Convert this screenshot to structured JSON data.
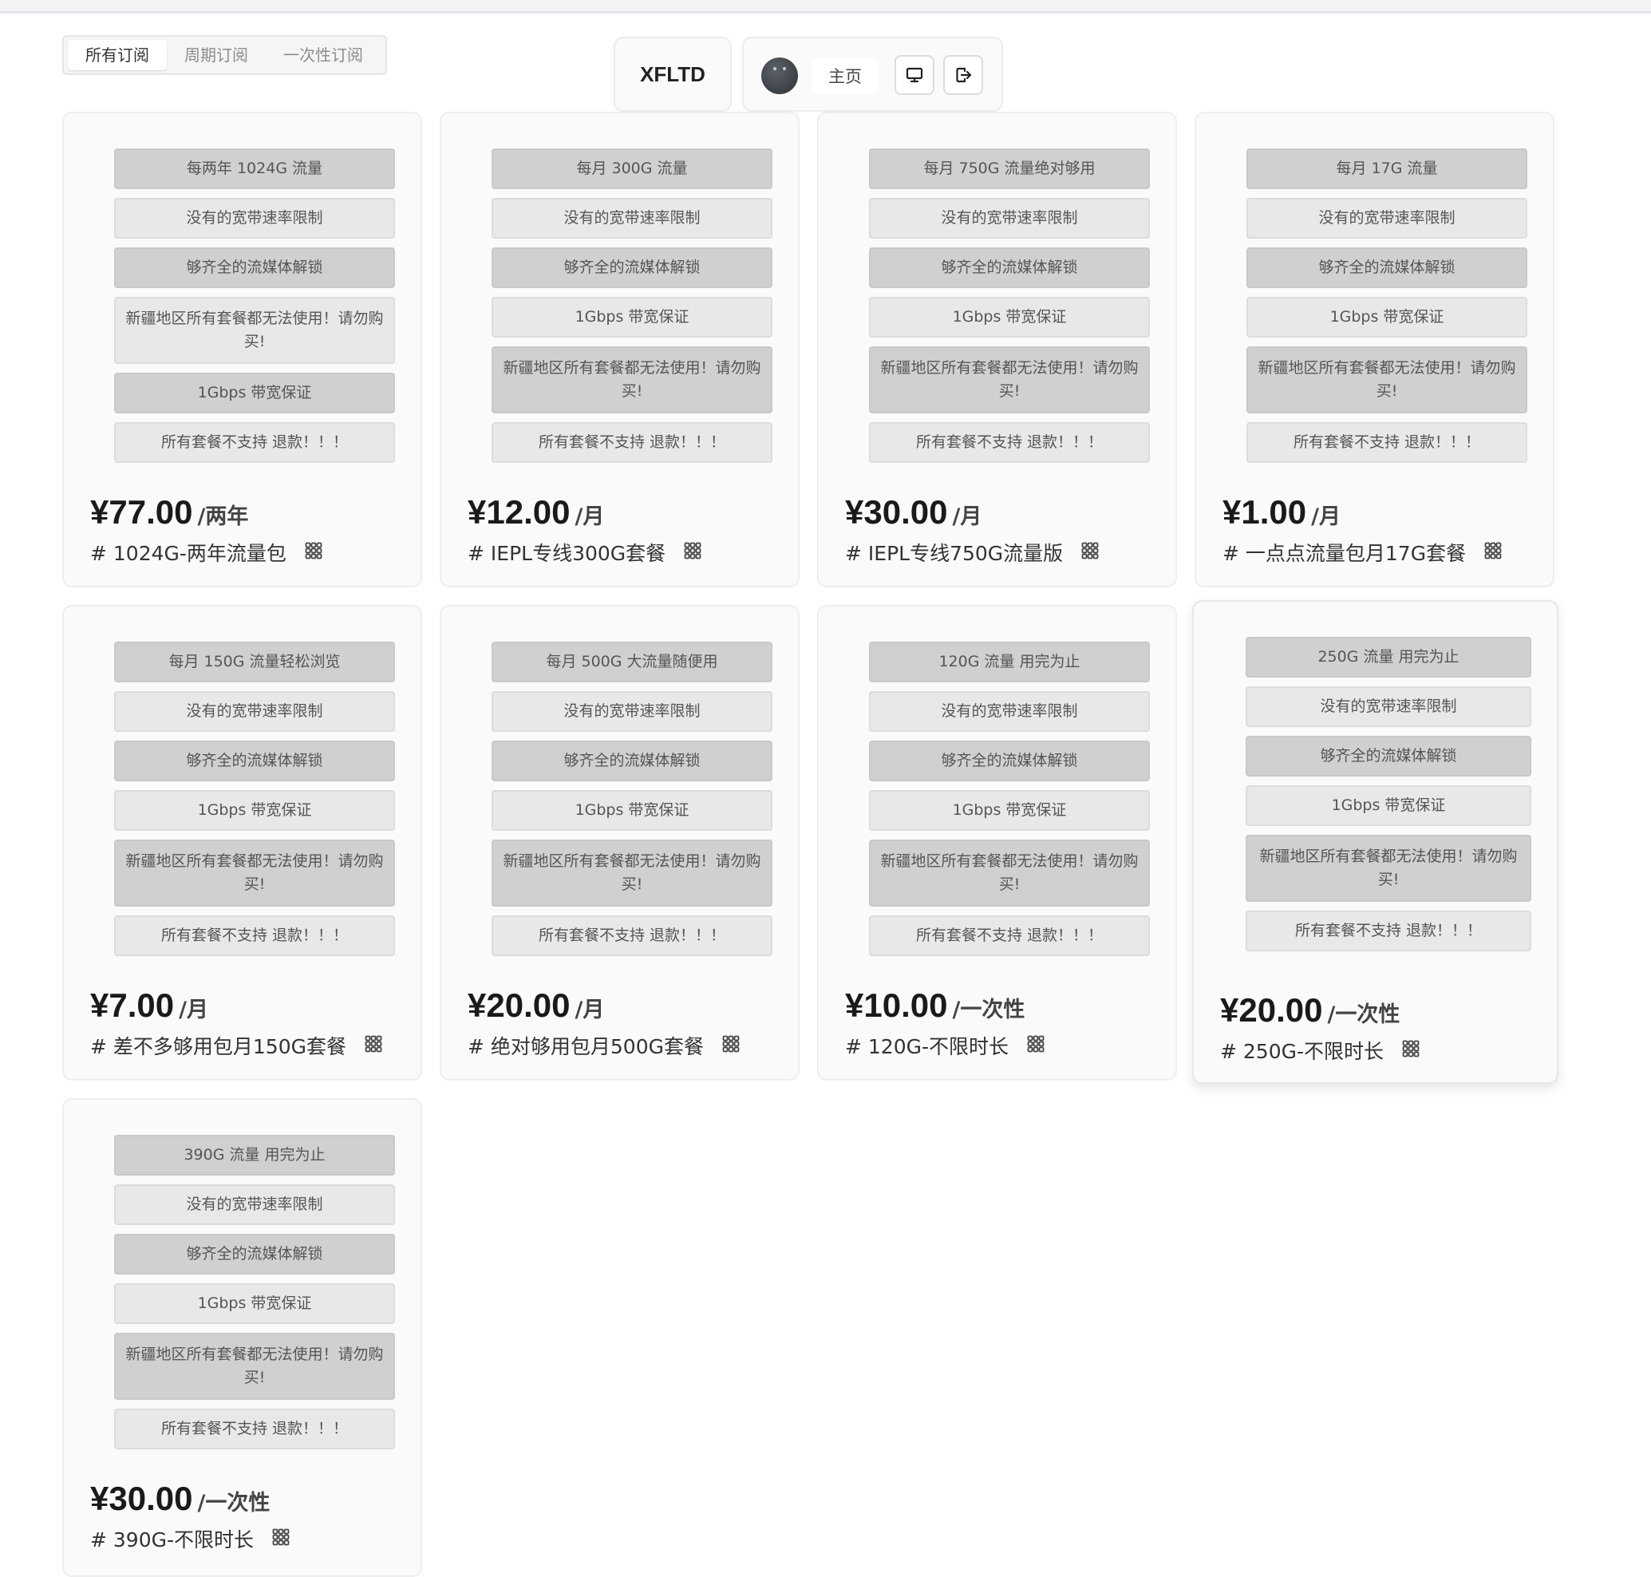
{
  "tabs": [
    "所有订阅",
    "周期订阅",
    "一次性订阅"
  ],
  "header": {
    "brand": "XFLTD",
    "home_label": "主页"
  },
  "icons": {
    "desktop": "desktop-icon",
    "logout": "logout-icon",
    "grid": "grid-icon"
  },
  "plans": [
    {
      "features": [
        "每两年 1024G 流量",
        "没有的宽带速率限制",
        "够齐全的流媒体解锁",
        "新疆地区所有套餐都无法使用！请勿购买!",
        "1Gbps 带宽保证",
        "所有套餐不支持 退款！！！"
      ],
      "price": "¥77.00",
      "period": "/两年",
      "name": "# 1024G-两年流量包"
    },
    {
      "features": [
        "每月 300G 流量",
        "没有的宽带速率限制",
        "够齐全的流媒体解锁",
        "1Gbps 带宽保证",
        "新疆地区所有套餐都无法使用！请勿购买!",
        "所有套餐不支持 退款！！！"
      ],
      "price": "¥12.00",
      "period": "/月",
      "name": "# IEPL专线300G套餐"
    },
    {
      "features": [
        "每月 750G 流量绝对够用",
        "没有的宽带速率限制",
        "够齐全的流媒体解锁",
        "1Gbps 带宽保证",
        "新疆地区所有套餐都无法使用！请勿购买!",
        "所有套餐不支持 退款！！！"
      ],
      "price": "¥30.00",
      "period": "/月",
      "name": "# IEPL专线750G流量版"
    },
    {
      "features": [
        "每月 17G 流量",
        "没有的宽带速率限制",
        "够齐全的流媒体解锁",
        "1Gbps 带宽保证",
        "新疆地区所有套餐都无法使用！请勿购买!",
        "所有套餐不支持 退款！！！"
      ],
      "price": "¥1.00",
      "period": "/月",
      "name": "# 一点点流量包月17G套餐"
    },
    {
      "features": [
        "每月 150G 流量轻松浏览",
        "没有的宽带速率限制",
        "够齐全的流媒体解锁",
        "1Gbps 带宽保证",
        "新疆地区所有套餐都无法使用！请勿购买!",
        "所有套餐不支持 退款！！！"
      ],
      "price": "¥7.00",
      "period": "/月",
      "name": "# 差不多够用包月150G套餐"
    },
    {
      "features": [
        "每月 500G 大流量随便用",
        "没有的宽带速率限制",
        "够齐全的流媒体解锁",
        "1Gbps 带宽保证",
        "新疆地区所有套餐都无法使用！请勿购买!",
        "所有套餐不支持 退款！！！"
      ],
      "price": "¥20.00",
      "period": "/月",
      "name": "# 绝对够用包月500G套餐"
    },
    {
      "features": [
        "120G 流量 用完为止",
        "没有的宽带速率限制",
        "够齐全的流媒体解锁",
        "1Gbps 带宽保证",
        "新疆地区所有套餐都无法使用！请勿购买!",
        "所有套餐不支持 退款！！！"
      ],
      "price": "¥10.00",
      "period": "/一次性",
      "name": "# 120G-不限时长"
    },
    {
      "features": [
        "250G 流量 用完为止",
        "没有的宽带速率限制",
        "够齐全的流媒体解锁",
        "1Gbps 带宽保证",
        "新疆地区所有套餐都无法使用！请勿购买!",
        "所有套餐不支持 退款！！！"
      ],
      "price": "¥20.00",
      "period": "/一次性",
      "name": "# 250G-不限时长"
    },
    {
      "features": [
        "390G 流量 用完为止",
        "没有的宽带速率限制",
        "够齐全的流媒体解锁",
        "1Gbps 带宽保证",
        "新疆地区所有套餐都无法使用！请勿购买!",
        "所有套餐不支持 退款！！！"
      ],
      "price": "¥30.00",
      "period": "/一次性",
      "name": "# 390G-不限时长"
    }
  ]
}
